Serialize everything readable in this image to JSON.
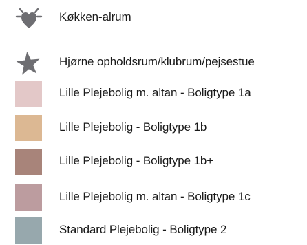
{
  "legend": {
    "items": [
      {
        "label": "Køkken-alrum",
        "icon": "heart-icon",
        "color": "#6e6e72"
      },
      {
        "label": "Hjørne opholdsrum/klubrum/pejsestue",
        "icon": "star-icon",
        "color": "#6e6e72"
      },
      {
        "label": "Lille Plejebolig m. altan - Boligtype 1a",
        "color": "#e3c8c8"
      },
      {
        "label": "Lille Plejebolig - Boligtype 1b",
        "color": "#dcb893"
      },
      {
        "label": "Lille Plejebolig - Boligtype 1b+",
        "color": "#a8847a"
      },
      {
        "label": "Lille Plejebolig m. altan - Boligtype 1c",
        "color": "#bc9c9f"
      },
      {
        "label": "Standard Plejebolig - Boligtype 2",
        "color": "#97a8ad"
      }
    ]
  }
}
